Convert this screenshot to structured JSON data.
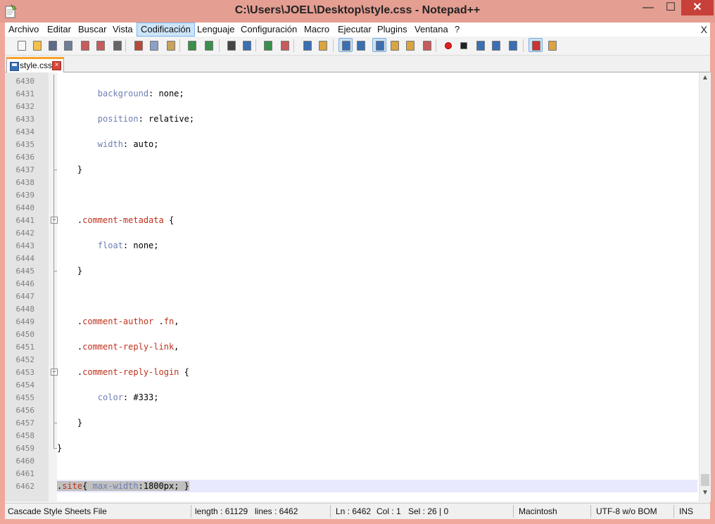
{
  "window": {
    "title": "C:\\Users\\JOEL\\Desktop\\style.css - Notepad++",
    "minimize_glyph": "—",
    "maximize_glyph": "☐",
    "close_glyph": "✕"
  },
  "menu": {
    "items": [
      "Archivo",
      "Editar",
      "Buscar",
      "Vista",
      "Codificación",
      "Lenguaje",
      "Configuración",
      "Macro",
      "Ejecutar",
      "Plugins",
      "Ventana",
      "?"
    ],
    "active": "Codificación",
    "close_label": "X"
  },
  "toolbar": {
    "icons": [
      "new-file-icon",
      "open-file-icon",
      "save-icon",
      "save-all-icon",
      "close-icon",
      "close-all-icon",
      "print-icon",
      "cut-icon",
      "copy-icon",
      "paste-icon",
      "undo-icon",
      "redo-icon",
      "find-icon",
      "replace-icon",
      "zoom-in-icon",
      "zoom-out-icon",
      "sync-vertical-icon",
      "sync-horizontal-icon",
      "word-wrap-icon",
      "show-all-chars-icon",
      "indent-guide-icon",
      "user-language-icon",
      "doc-map-icon",
      "function-list-icon",
      "record-macro-icon",
      "stop-macro-icon",
      "play-macro-icon",
      "run-macro-multiple-icon",
      "save-macro-icon",
      "spell-check-icon",
      "spell-settings-icon"
    ]
  },
  "tab": {
    "label": "style.css"
  },
  "editor": {
    "lines": [
      {
        "n": "6430",
        "segs": []
      },
      {
        "n": "6431",
        "segs": [
          {
            "t": "        background",
            "c": "prop"
          },
          {
            "t": ": none;",
            "c": "val"
          }
        ]
      },
      {
        "n": "6432",
        "segs": []
      },
      {
        "n": "6433",
        "segs": [
          {
            "t": "        position",
            "c": "prop"
          },
          {
            "t": ": relative;",
            "c": "val"
          }
        ]
      },
      {
        "n": "6434",
        "segs": []
      },
      {
        "n": "6435",
        "segs": [
          {
            "t": "        width",
            "c": "prop"
          },
          {
            "t": ": auto;",
            "c": "val"
          }
        ]
      },
      {
        "n": "6436",
        "segs": []
      },
      {
        "n": "6437",
        "segs": [
          {
            "t": "    }",
            "c": "val"
          }
        ]
      },
      {
        "n": "6438",
        "segs": []
      },
      {
        "n": "6439",
        "segs": []
      },
      {
        "n": "6440",
        "segs": []
      },
      {
        "n": "6441",
        "segs": [
          {
            "t": "    .",
            "c": "val"
          },
          {
            "t": "comment-metadata",
            "c": "tok-red"
          },
          {
            "t": " {",
            "c": "val"
          }
        ]
      },
      {
        "n": "6442",
        "segs": []
      },
      {
        "n": "6443",
        "segs": [
          {
            "t": "        float",
            "c": "prop"
          },
          {
            "t": ": none;",
            "c": "val"
          }
        ]
      },
      {
        "n": "6444",
        "segs": []
      },
      {
        "n": "6445",
        "segs": [
          {
            "t": "    }",
            "c": "val"
          }
        ]
      },
      {
        "n": "6446",
        "segs": []
      },
      {
        "n": "6447",
        "segs": []
      },
      {
        "n": "6448",
        "segs": []
      },
      {
        "n": "6449",
        "segs": [
          {
            "t": "    .",
            "c": "val"
          },
          {
            "t": "comment-author",
            "c": "tok-red"
          },
          {
            "t": " .",
            "c": "val"
          },
          {
            "t": "fn",
            "c": "tok-red"
          },
          {
            "t": ",",
            "c": "val"
          }
        ]
      },
      {
        "n": "6450",
        "segs": []
      },
      {
        "n": "6451",
        "segs": [
          {
            "t": "    .",
            "c": "val"
          },
          {
            "t": "comment-reply-link",
            "c": "tok-red"
          },
          {
            "t": ",",
            "c": "val"
          }
        ]
      },
      {
        "n": "6452",
        "segs": []
      },
      {
        "n": "6453",
        "segs": [
          {
            "t": "    .",
            "c": "val"
          },
          {
            "t": "comment-reply-login",
            "c": "tok-red"
          },
          {
            "t": " {",
            "c": "val"
          }
        ]
      },
      {
        "n": "6454",
        "segs": []
      },
      {
        "n": "6455",
        "segs": [
          {
            "t": "        color",
            "c": "prop"
          },
          {
            "t": ": #333;",
            "c": "val"
          }
        ]
      },
      {
        "n": "6456",
        "segs": []
      },
      {
        "n": "6457",
        "segs": [
          {
            "t": "    }",
            "c": "val"
          }
        ]
      },
      {
        "n": "6458",
        "segs": []
      },
      {
        "n": "6459",
        "segs": [
          {
            "t": "}",
            "c": "val"
          }
        ]
      },
      {
        "n": "6460",
        "segs": []
      },
      {
        "n": "6461",
        "segs": []
      },
      {
        "n": "6462",
        "segs": [
          {
            "t": ".",
            "c": "val"
          },
          {
            "t": "site",
            "c": "tok-red"
          },
          {
            "t": "{ ",
            "c": "val"
          },
          {
            "t": "max-width",
            "c": "prop"
          },
          {
            "t": ":1800px; }",
            "c": "val"
          }
        ]
      }
    ]
  },
  "status": {
    "file_type": "Cascade Style Sheets File",
    "length": "length : 61129",
    "lines": "lines : 6462",
    "ln": "Ln : 6462",
    "col": "Col : 1",
    "sel": "Sel : 26 | 0",
    "eol": "Macintosh",
    "encoding": "UTF-8 w/o BOM",
    "mode": "INS"
  }
}
